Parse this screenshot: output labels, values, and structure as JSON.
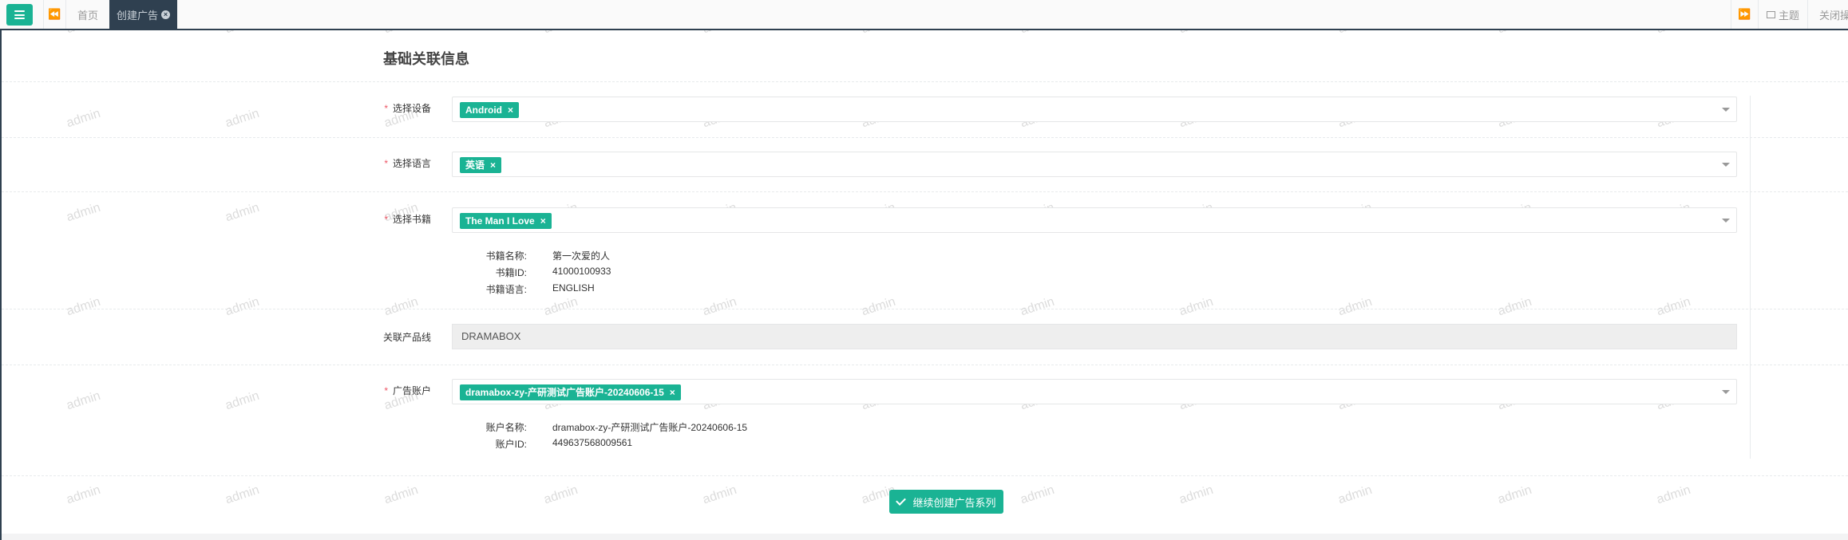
{
  "topbar": {
    "home_tab": "首页",
    "active_tab": "创建广告",
    "theme_label": "主题",
    "close_ops_label": "关闭操作"
  },
  "form": {
    "section_title": "基础关联信息",
    "device": {
      "label": "选择设备",
      "required_mark": "*",
      "tags": [
        "Android"
      ]
    },
    "language": {
      "label": "选择语言",
      "required_mark": "*",
      "tags": [
        "英语"
      ]
    },
    "book": {
      "label": "选择书籍",
      "required_mark": "*",
      "tags": [
        "The Man I Love"
      ],
      "info": [
        {
          "key": "书籍名称:",
          "value": "第一次爱的人"
        },
        {
          "key": "书籍ID:",
          "value": "41000100933"
        },
        {
          "key": "书籍语言:",
          "value": "ENGLISH"
        }
      ]
    },
    "product_line": {
      "label": "关联产品线",
      "value": "DRAMABOX"
    },
    "ad_account": {
      "label": "广告账户",
      "required_mark": "*",
      "tags": [
        "dramabox-zy-产研测试广告账户-20240606-15"
      ],
      "info": [
        {
          "key": "账户名称:",
          "value": "dramabox-zy-产研测试广告账户-20240606-15"
        },
        {
          "key": "账户ID:",
          "value": "449637568009561"
        }
      ]
    },
    "tag_remove": "×",
    "submit_label": "继续创建广告系列"
  },
  "watermark": {
    "text": "admin"
  },
  "colors": {
    "accent": "#1ab394",
    "nav_dark": "#2f4050",
    "required": "#ed5565"
  },
  "icons": {
    "menu": "hamburger-icon",
    "prev": "double-chevron-left-icon",
    "next": "double-chevron-right-icon",
    "theme": "theme-icon",
    "tab_close": "close-circle-icon",
    "submit": "check-icon"
  }
}
